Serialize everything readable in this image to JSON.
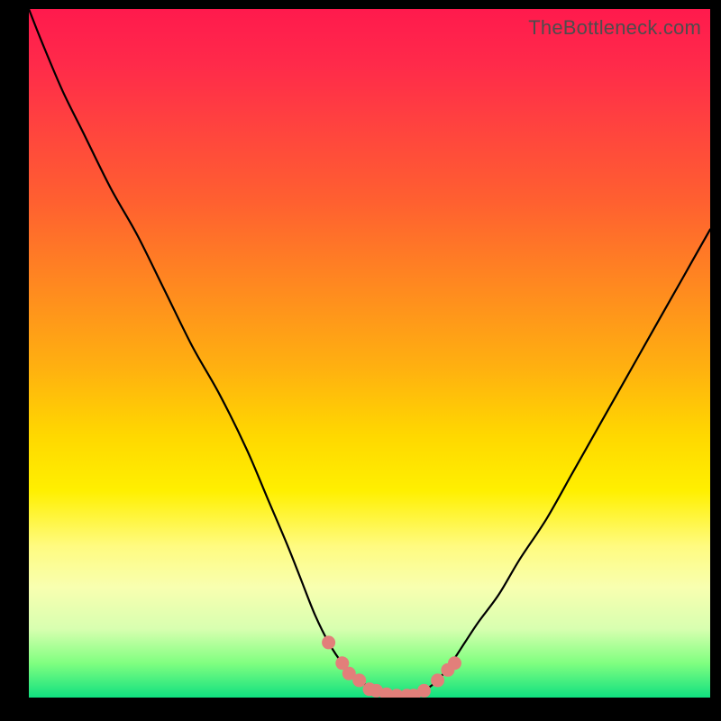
{
  "watermark": "TheBottleneck.com",
  "colors": {
    "frame_border": "#000000",
    "curve_stroke": "#000000",
    "marker_fill": "#e27f7a",
    "gradient_top": "#ff1a4d",
    "gradient_bottom": "#10e080"
  },
  "chart_data": {
    "type": "line",
    "title": "",
    "xlabel": "",
    "ylabel": "",
    "xlim": [
      0,
      100
    ],
    "ylim": [
      0,
      100
    ],
    "grid": false,
    "legend": false,
    "x": [
      0,
      2,
      5,
      8,
      12,
      16,
      20,
      24,
      28,
      32,
      35,
      38,
      40,
      42,
      44,
      46,
      48.5,
      51,
      54,
      56.5,
      58,
      60,
      62,
      64,
      66,
      69,
      72,
      76,
      80,
      84,
      88,
      92,
      96,
      100
    ],
    "y": [
      100,
      95,
      88,
      82,
      74,
      67,
      59,
      51,
      44,
      36,
      29,
      22,
      17,
      12,
      8,
      5,
      2.5,
      1,
      0.3,
      0.3,
      1,
      2.5,
      5,
      8,
      11,
      15,
      20,
      26,
      33,
      40,
      47,
      54,
      61,
      68
    ],
    "markers": {
      "x": [
        44,
        46,
        47,
        48.5,
        50,
        51,
        52.5,
        54,
        55.5,
        56.5,
        58,
        60,
        61.5,
        62.5
      ],
      "y": [
        8,
        5,
        3.5,
        2.5,
        1.2,
        1,
        0.5,
        0.3,
        0.3,
        0.3,
        1,
        2.5,
        4,
        5
      ]
    }
  }
}
